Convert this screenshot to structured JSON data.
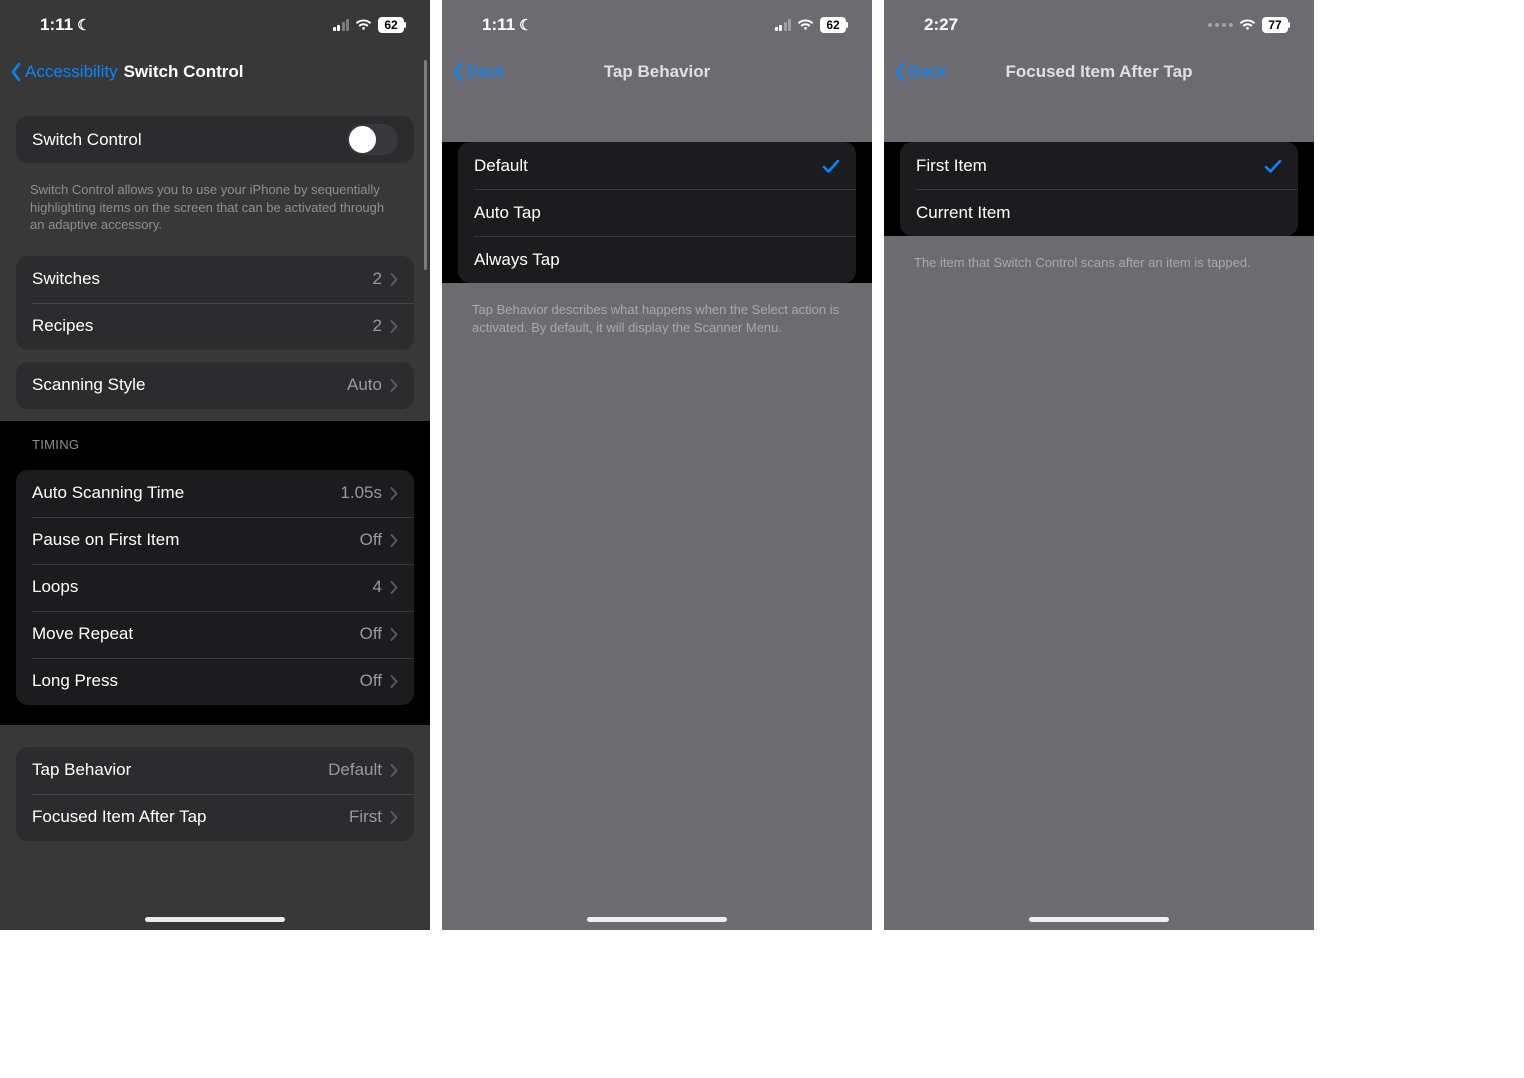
{
  "screens": [
    {
      "status": {
        "time": "1:11",
        "dnd": true,
        "battery": "62",
        "signal_style": "bars-partial"
      },
      "nav": {
        "back": "Accessibility",
        "title": "Switch Control",
        "title_centered": false
      },
      "switch_control": {
        "toggle_label": "Switch Control",
        "toggle_on": false,
        "description": "Switch Control allows you to use your iPhone by sequentially highlighting items on the screen that can be activated through an adaptive accessory."
      },
      "rows_a": [
        {
          "label": "Switches",
          "value": "2"
        },
        {
          "label": "Recipes",
          "value": "2"
        }
      ],
      "rows_b": [
        {
          "label": "Scanning Style",
          "value": "Auto"
        }
      ],
      "timing_header": "TIMING",
      "timing_rows": [
        {
          "label": "Auto Scanning Time",
          "value": "1.05s"
        },
        {
          "label": "Pause on First Item",
          "value": "Off"
        },
        {
          "label": "Loops",
          "value": "4"
        },
        {
          "label": "Move Repeat",
          "value": "Off"
        },
        {
          "label": "Long Press",
          "value": "Off"
        }
      ],
      "rows_c": [
        {
          "label": "Tap Behavior",
          "value": "Default"
        },
        {
          "label": "Focused Item After Tap",
          "value": "First"
        }
      ]
    },
    {
      "status": {
        "time": "1:11",
        "dnd": true,
        "battery": "62",
        "signal_style": "bars-partial"
      },
      "nav": {
        "back": "Back",
        "title": "Tap Behavior",
        "title_centered": true
      },
      "options": [
        {
          "label": "Default",
          "selected": true
        },
        {
          "label": "Auto Tap",
          "selected": false
        },
        {
          "label": "Always Tap",
          "selected": false
        }
      ],
      "footer": "Tap Behavior describes what happens when the Select action is activated. By default, it will display the Scanner Menu."
    },
    {
      "status": {
        "time": "2:27",
        "dnd": false,
        "battery": "77",
        "signal_style": "dots"
      },
      "nav": {
        "back": "Back",
        "title": "Focused Item After Tap",
        "title_centered": true
      },
      "options": [
        {
          "label": "First Item",
          "selected": true
        },
        {
          "label": "Current Item",
          "selected": false
        }
      ],
      "footer": "The item that Switch Control scans after an item is tapped."
    }
  ]
}
